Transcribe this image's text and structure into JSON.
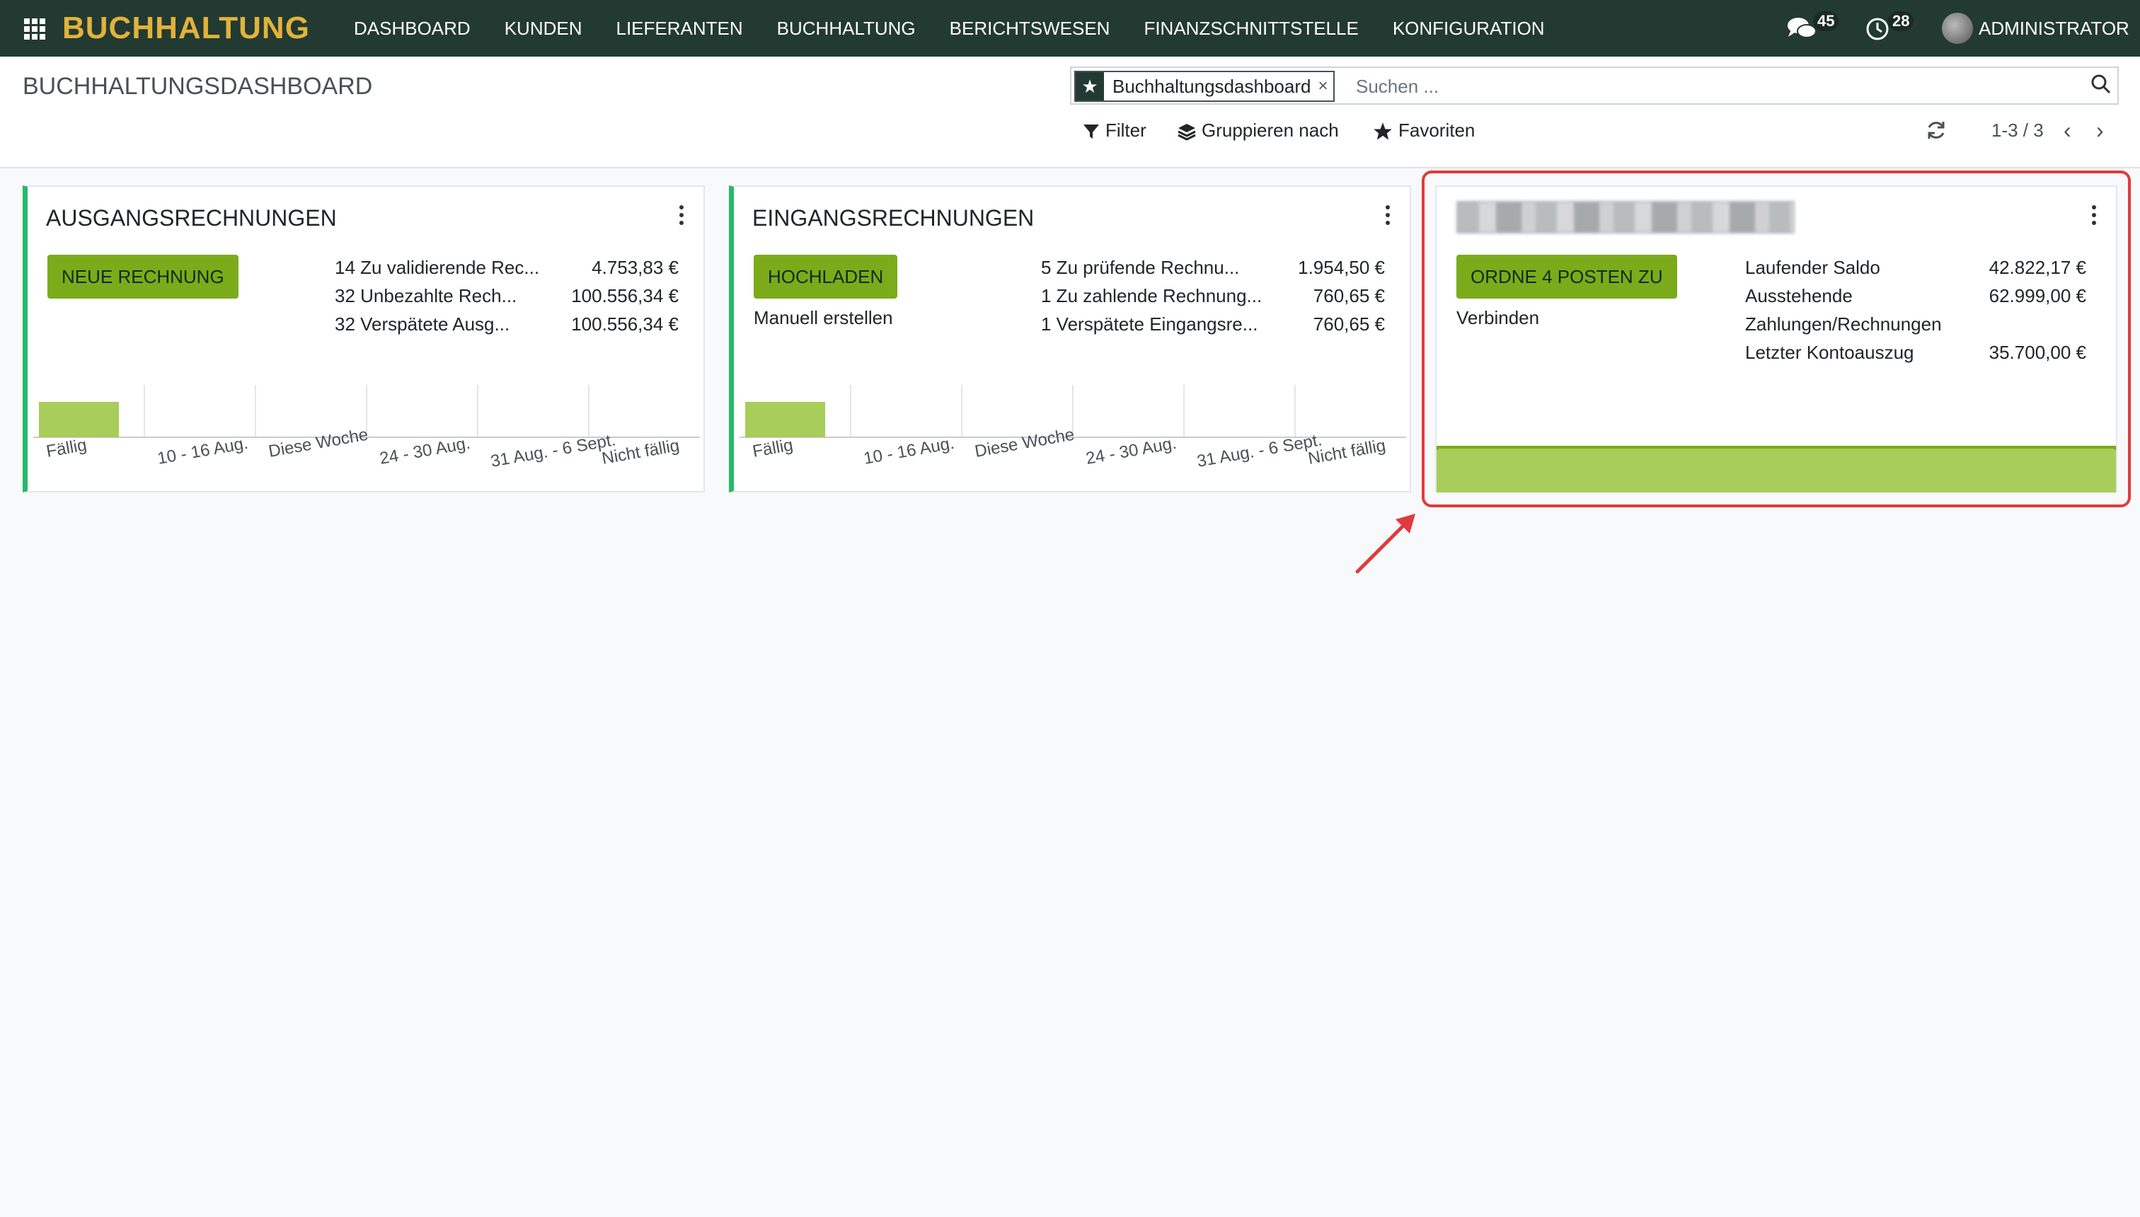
{
  "navbar": {
    "brand": "BUCHHALTUNG",
    "menu": [
      "DASHBOARD",
      "KUNDEN",
      "LIEFERANTEN",
      "BUCHHALTUNG",
      "BERICHTSWESEN",
      "FINANZSCHNITTSTELLE",
      "KONFIGURATION"
    ],
    "messages_count": "45",
    "activities_count": "28",
    "user": "ADMINISTRATOR"
  },
  "control": {
    "title": "BUCHHALTUNGSDASHBOARD",
    "facet_label": "Buchhaltungsdashboard",
    "facet_close": "×",
    "search_placeholder": "Suchen ...",
    "filter": "Filter",
    "group_by": "Gruppieren nach",
    "favorites": "Favoriten",
    "pager": "1-3 / 3"
  },
  "cards": {
    "sale": {
      "title": "AUSGANGSRECHNUNGEN",
      "button": "NEUE RECHNUNG",
      "stats": [
        {
          "label": "14 Zu validierende Rec...",
          "value": "4.753,83 €"
        },
        {
          "label": "32 Unbezahlte Rech...",
          "value": "100.556,34 €"
        },
        {
          "label": "32 Verspätete Ausg...",
          "value": "100.556,34 €"
        }
      ]
    },
    "purchase": {
      "title": "EINGANGSRECHNUNGEN",
      "button": "HOCHLADEN",
      "link": "Manuell erstellen",
      "stats": [
        {
          "label": "5 Zu prüfende Rechnu...",
          "value": "1.954,50 €"
        },
        {
          "label": "1 Zu zahlende Rechnung...",
          "value": "760,65 €"
        },
        {
          "label": "1 Verspätete Eingangsre...",
          "value": "760,65 €"
        }
      ]
    },
    "bank": {
      "button": "ORDNE 4 POSTEN ZU",
      "link": "Verbinden",
      "stats": [
        {
          "label": "Laufender Saldo",
          "value": "42.822,17 €"
        },
        {
          "label": "Ausstehende Zahlungen/Rechnungen",
          "value": "62.999,00 €"
        },
        {
          "label": "Letzter Kontoauszug",
          "value": "35.700,00 €"
        }
      ]
    }
  },
  "chart_data": [
    {
      "type": "bar",
      "categories": [
        "Fällig",
        "10 - 16 Aug.",
        "Diese Woche",
        "24 - 30 Aug.",
        "31 Aug. - 6 Sept.",
        "Nicht fällig"
      ],
      "values": [
        1,
        0,
        0,
        0,
        0,
        0
      ],
      "color": "#a8cd5a"
    },
    {
      "type": "bar",
      "categories": [
        "Fällig",
        "10 - 16 Aug.",
        "Diese Woche",
        "24 - 30 Aug.",
        "31 Aug. - 6 Sept.",
        "Nicht fällig"
      ],
      "values": [
        1,
        0,
        0,
        0,
        0,
        0
      ],
      "color": "#a8cd5a"
    },
    {
      "type": "area",
      "values": [
        1,
        1
      ],
      "color": "#a8cd5a"
    }
  ],
  "colors": {
    "navbar": "#223a32",
    "brand": "#e2b23a",
    "button": "#7bab1a",
    "card_accent": "#28b96b",
    "chart": "#a8cd5a",
    "highlight": "#e03a3e"
  }
}
